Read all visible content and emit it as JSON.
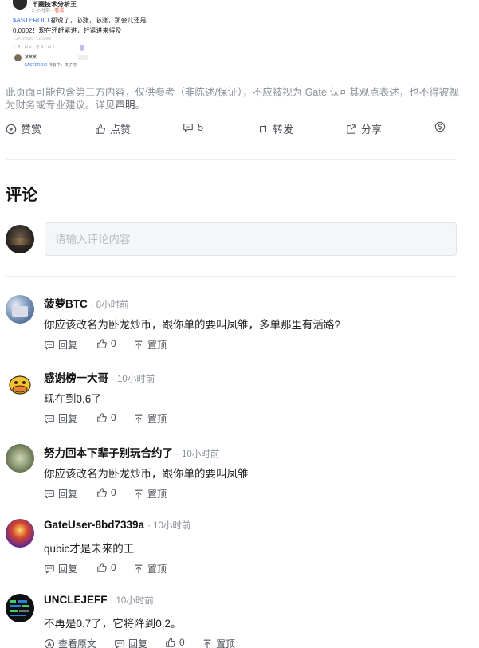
{
  "post_image": {
    "author": "币圈技术分析王",
    "time_prefix": "2 小时前 ·",
    "time_badge": "看涨",
    "hashtag": "$ASTEROID",
    "line1_rest": " 都说了，必涨，必涨，那会儿还是",
    "line2": "0.0002！现在还赶紧进，赶紧进来得及",
    "mini": "1.2K Views · 12 Likes",
    "mini_actions": "♡4 ⊡2 ◷8 ⊡2",
    "sub_author": "某某某",
    "sub_hashtag": "$ASTEROID",
    "sub_text": " 持有中，来了吧"
  },
  "disclaimer": {
    "text": "此页面可能包含第三方内容，仅供参考（非陈述/保证），不应被视为 Gate 认可其观点表述，也不得被视为财务或专业建议。详见",
    "link": "声明",
    "end": "。"
  },
  "actions": {
    "reward": "赞赏",
    "like": "点赞",
    "comment_count": "5",
    "repost": "转发",
    "share": "分享"
  },
  "comments_section": {
    "title": "评论",
    "input_placeholder": "请输入评论内容"
  },
  "comments": [
    {
      "user": "菠萝BTC",
      "time": "· 8小时前",
      "text": "你应该改名为卧龙炒币，跟你单的要叫凤雏，多单那里有活路?",
      "reply": "回复",
      "likes": "0",
      "pin": "置顶"
    },
    {
      "user": "感谢榜一大哥",
      "time": "· 10小时前",
      "text": "现在到0.6了",
      "reply": "回复",
      "likes": "0",
      "pin": "置顶"
    },
    {
      "user": "努力回本下辈子别玩合约了",
      "time": "· 10小时前",
      "text": "你应该改名为卧龙炒币，跟你单的要叫凤雏",
      "reply": "回复",
      "likes": "0",
      "pin": "置顶"
    },
    {
      "user": "GateUser-8bd7339a",
      "time": "· 10小时前",
      "text": "qubic才是未来的王",
      "reply": "回复",
      "likes": "0",
      "pin": "置顶"
    },
    {
      "user": "UNCLEJEFF",
      "time": "· 10小时前",
      "text": "不再是0.7了，它将降到0.2。",
      "view_original": "查看原文",
      "reply": "回复",
      "likes": "0",
      "pin": "置顶"
    }
  ]
}
